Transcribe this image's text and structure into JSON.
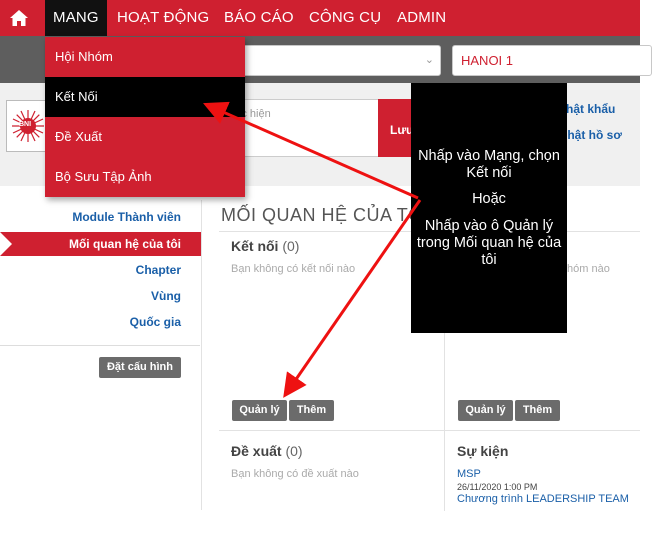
{
  "nav": {
    "items": [
      "MANG",
      "HOẠT ĐỘNG",
      "BÁO CÁO",
      "CÔNG CỤ",
      "ADMIN"
    ],
    "active": "MANG"
  },
  "filter": {
    "region": "HANOI 1"
  },
  "header": {
    "search_placeholder": "ực hiện",
    "save_label": "Lưu",
    "link_export": "hật khẩu",
    "link_profile": "nhật hồ sơ",
    "logo_text": "BNI"
  },
  "dropdown": {
    "items": [
      "Hội Nhóm",
      "Kết Nối",
      "Đề Xuất",
      "Bộ Sưu Tập Ảnh"
    ],
    "active_index": 1
  },
  "sidebar": {
    "items": [
      "Module Thành viên",
      "Mối quan hệ của tôi",
      "Chapter",
      "Vùng",
      "Quốc gia"
    ],
    "active_index": 1,
    "config_button": "Đặt cấu hình"
  },
  "main": {
    "title": "MỐI QUAN HỆ CỦA TÔI",
    "connections": {
      "title": "Kết nối",
      "count": "(0)",
      "empty": "Bạn không có kết nối nào"
    },
    "right_top_empty": "hóm nào",
    "referrals": {
      "title": "Đề xuất",
      "count": "(0)",
      "empty": "Bạn không có đề xuất nào"
    },
    "events": {
      "title": "Sự kiện",
      "event_name": "MSP",
      "event_date": "26/11/2020 1:00 PM",
      "event_program": "Chương trình LEADERSHIP TEAM"
    },
    "manage_label": "Quản lý",
    "add_label": "Thêm"
  },
  "annotation": {
    "line1": "Nhấp vào Mạng, chọn Kết nối",
    "line2": "Hoặc",
    "line3": "Nhấp vào ô Quản lý  trong Mối quan hệ của tôi"
  },
  "colors": {
    "brand_red": "#cf2030",
    "link_blue": "#1a5fa8",
    "filter_grey": "#5e5e5e",
    "button_grey": "#6b6b6b"
  },
  "icons": {
    "home": "home-icon",
    "chevron": "chevron-down-icon",
    "logo": "bni-logo-icon"
  }
}
